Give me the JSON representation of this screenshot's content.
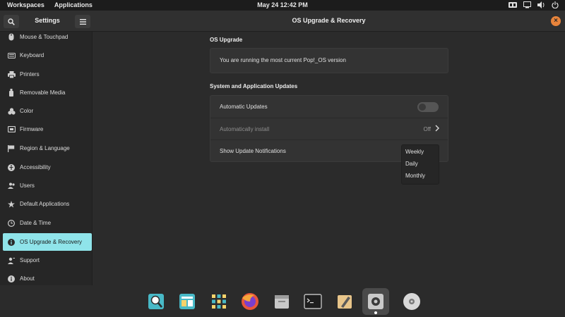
{
  "topbar": {
    "workspaces": "Workspaces",
    "applications": "Applications",
    "datetime": "May 24  12:42 PM"
  },
  "header": {
    "settings_title": "Settings",
    "page_title": "OS Upgrade & Recovery"
  },
  "sidebar": {
    "items": [
      {
        "label": "Mouse & Touchpad",
        "icon": "mouse-icon"
      },
      {
        "label": "Keyboard",
        "icon": "keyboard-icon"
      },
      {
        "label": "Printers",
        "icon": "printer-icon"
      },
      {
        "label": "Removable Media",
        "icon": "usb-icon"
      },
      {
        "label": "Color",
        "icon": "color-icon"
      },
      {
        "label": "Firmware",
        "icon": "firmware-icon"
      },
      {
        "label": "Region & Language",
        "icon": "flag-icon"
      },
      {
        "label": "Accessibility",
        "icon": "accessibility-icon"
      },
      {
        "label": "Users",
        "icon": "users-icon"
      },
      {
        "label": "Default Applications",
        "icon": "star-icon"
      },
      {
        "label": "Date & Time",
        "icon": "clock-icon"
      },
      {
        "label": "OS Upgrade & Recovery",
        "icon": "info-icon",
        "active": true
      },
      {
        "label": "Support",
        "icon": "support-icon"
      },
      {
        "label": "About",
        "icon": "about-icon"
      }
    ]
  },
  "main": {
    "os_upgrade_title": "OS Upgrade",
    "os_upgrade_status": "You are running the most current Pop!_OS version",
    "updates_title": "System and Application Updates",
    "automatic_updates_label": "Automatic Updates",
    "automatic_updates_enabled": false,
    "automatically_install_label": "Automatically install",
    "automatically_install_value": "Off",
    "show_notifications_label": "Show Update Notifications"
  },
  "dropdown": {
    "options": [
      "Weekly",
      "Daily",
      "Monthly"
    ]
  },
  "dock": {
    "apps": [
      {
        "name": "search-app-icon"
      },
      {
        "name": "workspaces-app-icon"
      },
      {
        "name": "app-grid-icon"
      },
      {
        "name": "firefox-icon"
      },
      {
        "name": "files-icon"
      },
      {
        "name": "terminal-icon"
      },
      {
        "name": "text-editor-icon"
      },
      {
        "name": "settings-app-icon",
        "active": true
      },
      {
        "name": "disk-icon"
      }
    ]
  },
  "colors": {
    "accent": "#8fe4ea",
    "close_button": "#e8843b",
    "background": "#2b2b2b",
    "panel": "#333333"
  }
}
